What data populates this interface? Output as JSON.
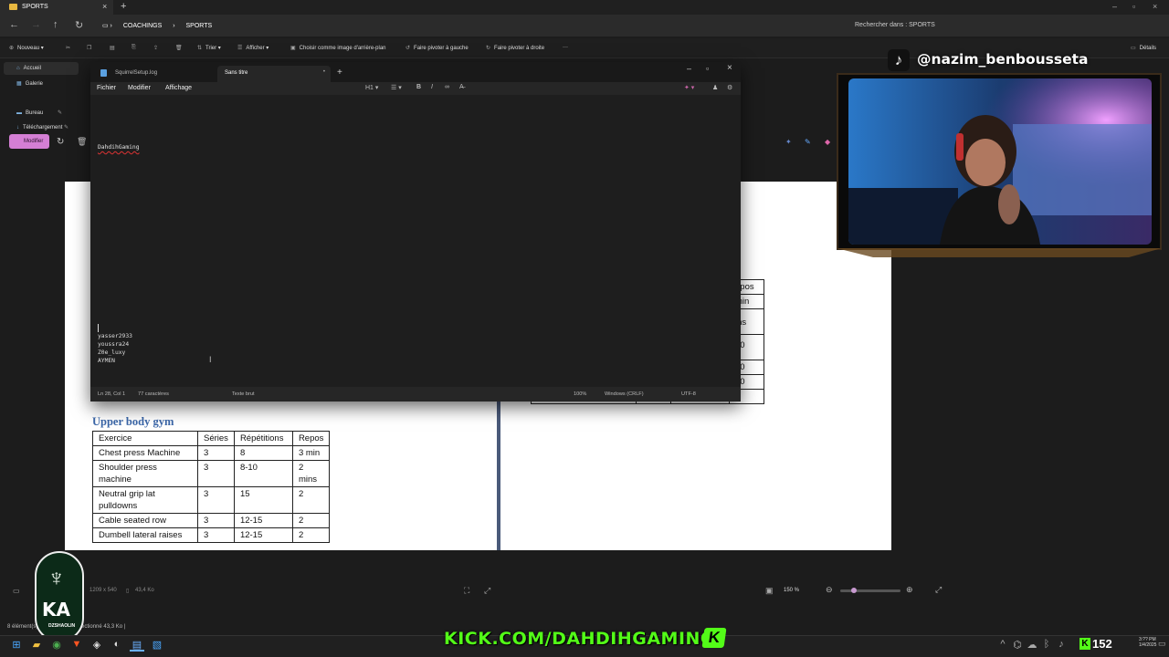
{
  "explorer": {
    "tab_title": "SPORTS",
    "breadcrumb": [
      "COACHINGS",
      "SPORTS"
    ],
    "search_placeholder": "Rechercher dans : SPORTS",
    "toolbar": {
      "new_label": "Nouveau",
      "sort_label": "Trier",
      "view_label": "Afficher",
      "wallpaper_label": "Choisir comme image d'arrière-plan",
      "rotate_left_label": "Faire pivoter à gauche",
      "rotate_right_label": "Faire pivoter à droite",
      "details_label": "Détails"
    },
    "sidebar": [
      "Accueil",
      "Galerie",
      "Bureau",
      "Téléchargement"
    ],
    "status_left": "8 élément(s)",
    "status_selected": "ectionné 43,3 Ko"
  },
  "viewer": {
    "edit_label": "Modifier",
    "image_dims": "1209 x 540",
    "image_size": "43,4 Ko",
    "zoom": "150 %"
  },
  "document": {
    "heading": "Upper body gym",
    "left_table": {
      "headers": [
        "Exercice",
        "Séries",
        "Répétitions",
        "Repos"
      ],
      "rows": [
        [
          "Chest press Machine",
          "3",
          "8",
          "3 min"
        ],
        [
          "Shoulder press machine",
          "3",
          "8-10",
          "2 mins"
        ],
        [
          "Neutral grip lat pulldowns",
          "3",
          "15",
          "2"
        ],
        [
          "Cable seated row",
          "3",
          "12-15",
          "2"
        ],
        [
          "Dumbell lateral raises",
          "3",
          "12-15",
          "2"
        ]
      ]
    },
    "right_table_visible": {
      "header_fragment": "epos",
      "cells": [
        "min",
        "ins",
        "30",
        "30",
        "30",
        "Machine"
      ]
    }
  },
  "notepad": {
    "tabs": [
      "SquirrelSetup.log",
      "Sans titre"
    ],
    "menu": [
      "Fichier",
      "Modifier",
      "Affichage"
    ],
    "heading_dropdown": "H1",
    "lines_top": [
      "DahdihGaming"
    ],
    "lines_bottom": [
      "yasser2933",
      "youssra24",
      "Z0e_luxy",
      "AYMEN"
    ],
    "status": {
      "position": "Ln 28, Col 1",
      "chars": "77 caractères",
      "format": "Texte brut",
      "zoom": "100%",
      "line_ending": "Windows (CRLF)",
      "encoding": "UTF-8"
    }
  },
  "overlay": {
    "tiktok_handle": "@nazim_benbousseta",
    "kick_url": "KICK.COM/DAHDIHGAMING",
    "kick_logo": "K",
    "viewer_count": "152",
    "logo_text": "KA",
    "logo_sub": "DZSHAOLIN"
  },
  "taskbar": {
    "clock_time": "3:?? PM",
    "clock_date": "1/4/2025"
  },
  "colors": {
    "kick_green": "#53fc18",
    "doc_heading_blue": "#3a66a8",
    "edit_button_pink": "#d47fd4"
  }
}
